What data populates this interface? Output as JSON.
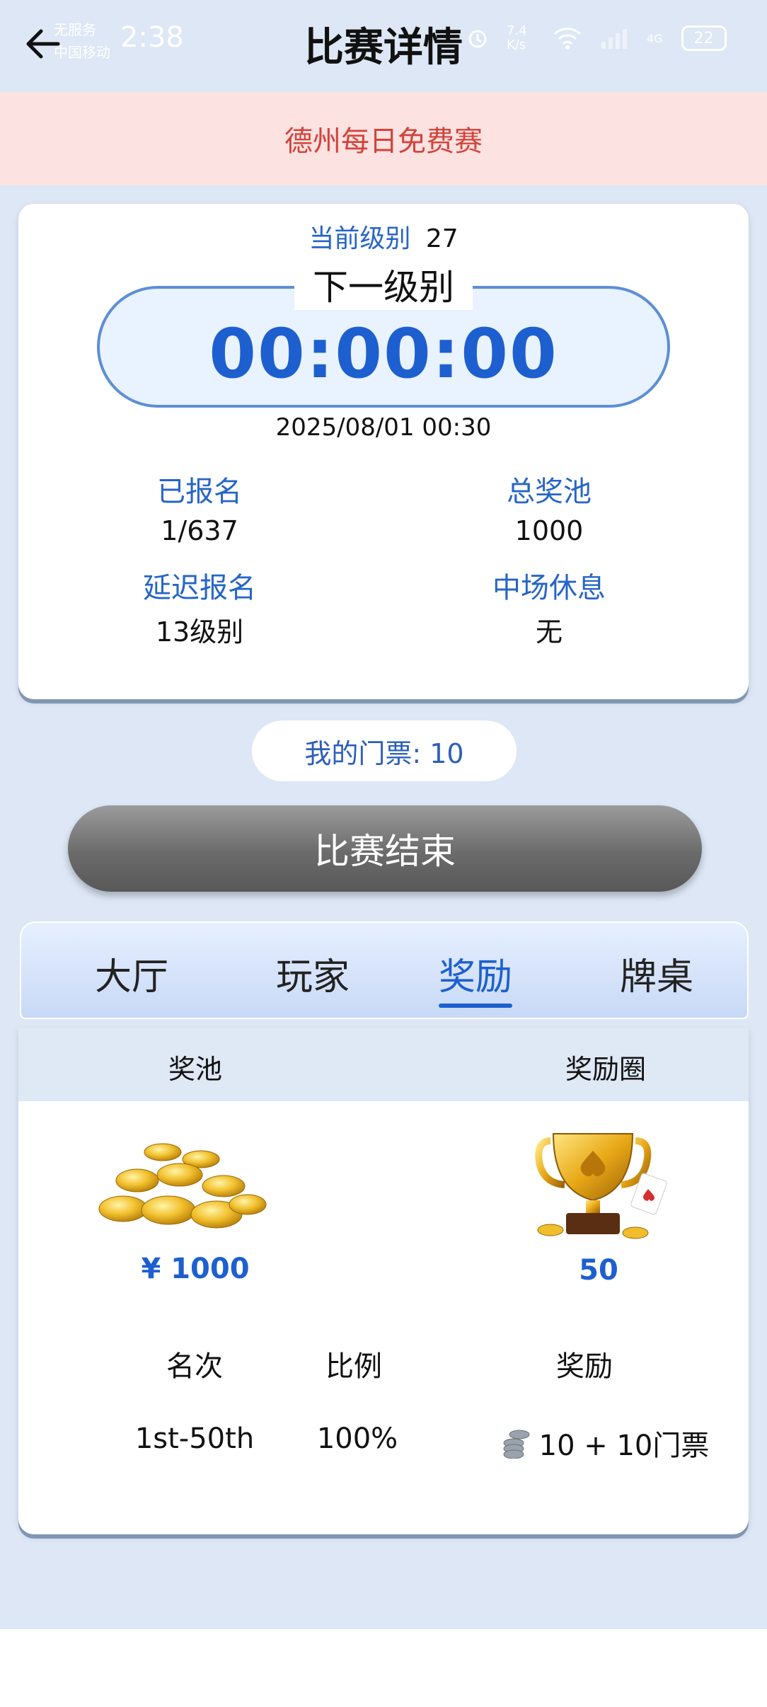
{
  "status_bar": {
    "carrier_line1": "无服务",
    "carrier_line2": "中国移动",
    "time": "2:38",
    "speed": "7.4 K/s",
    "network": "4G",
    "battery": "22"
  },
  "header": {
    "title": "比赛详情"
  },
  "banner": {
    "text": "德州每日免费赛"
  },
  "info": {
    "current_level_label": "当前级别",
    "current_level_value": "27",
    "next_level_label": "下一级别",
    "countdown": "00:00:00",
    "start_time": "2025/08/01 00:30",
    "registered_label": "已报名",
    "registered_value": "1/637",
    "prize_pool_label": "总奖池",
    "prize_pool_value": "1000",
    "late_reg_label": "延迟报名",
    "late_reg_value": "13级别",
    "break_label": "中场休息",
    "break_value": "无"
  },
  "ticket": {
    "text": "我的门票: 10"
  },
  "end_button": {
    "label": "比赛结束"
  },
  "tabs": [
    {
      "label": "大厅"
    },
    {
      "label": "玩家"
    },
    {
      "label": "奖励",
      "active": true
    },
    {
      "label": "牌桌"
    }
  ],
  "rewards": {
    "pool_header": "奖池",
    "circle_header": "奖励圈",
    "pool_amount": "¥ 1000",
    "circle_count": "50",
    "col_rank": "名次",
    "col_ratio": "比例",
    "col_reward": "奖励",
    "rows": [
      {
        "rank": "1st-50th",
        "ratio": "100%",
        "reward": "10 + 10门票"
      }
    ]
  },
  "colors": {
    "accent": "#1d5fcf",
    "banner_text": "#d2443b",
    "banner_bg": "#fde2e2",
    "page_bg": "#dde7f5"
  },
  "icons": [
    "back-arrow-icon",
    "alarm-icon",
    "wifi-icon",
    "signal-icon",
    "battery-icon",
    "gold-coins-icon",
    "trophy-icon",
    "chip-stack-icon"
  ]
}
